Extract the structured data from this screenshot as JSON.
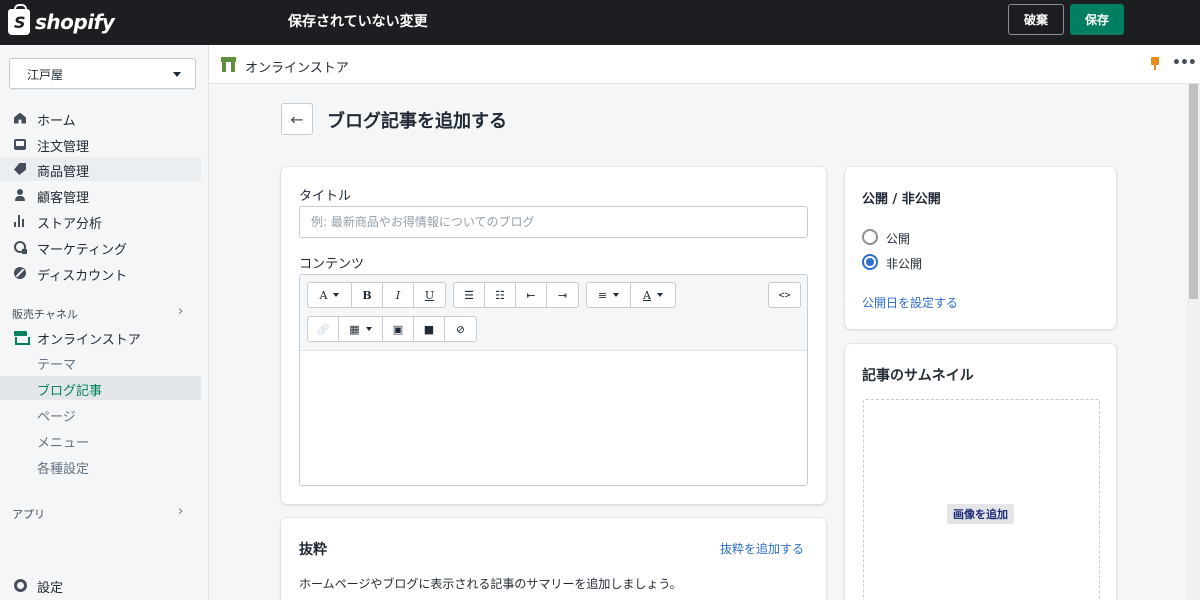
{
  "topbar": {
    "brand": "shopify",
    "unsaved_title": "保存されていない変更",
    "discard_label": "破棄",
    "save_label": "保存"
  },
  "sidebar": {
    "store_name": "江戸屋",
    "nav": [
      {
        "label": "ホーム",
        "icon": "home-icon"
      },
      {
        "label": "注文管理",
        "icon": "inbox-icon"
      },
      {
        "label": "商品管理",
        "icon": "tag-icon"
      },
      {
        "label": "顧客管理",
        "icon": "person-icon"
      },
      {
        "label": "ストア分析",
        "icon": "bar-chart-icon"
      },
      {
        "label": "マーケティング",
        "icon": "target-icon"
      },
      {
        "label": "ディスカウント",
        "icon": "discount-icon"
      }
    ],
    "sales_channels_label": "販売チャネル",
    "online_store_label": "オンラインストア",
    "sub_items": [
      "テーマ",
      "ブログ記事",
      "ページ",
      "メニュー",
      "各種設定"
    ],
    "apps_label": "アプリ",
    "settings_label": "設定"
  },
  "strip": {
    "title": "オンラインストア"
  },
  "page": {
    "title": "ブログ記事を追加する"
  },
  "main_card": {
    "title_label": "タイトル",
    "title_placeholder": "例: 最新商品やお得情報についてのブログ",
    "content_label": "コンテンツ",
    "toolbar": {
      "font": "A",
      "bold": "B",
      "italic": "I",
      "underline": "U",
      "html": "<>"
    }
  },
  "excerpt_card": {
    "heading": "抜粋",
    "add_link": "抜粋を追加する",
    "description": "ホームページやブログに表示される記事のサマリーを追加しましょう。"
  },
  "visibility_card": {
    "heading": "公開 / 非公開",
    "options": [
      "公開",
      "非公開"
    ],
    "selected": "非公開",
    "set_date_link": "公開日を設定する"
  },
  "thumbnail_card": {
    "heading": "記事のサムネイル",
    "add_image": "画像を追加"
  },
  "colors": {
    "topbar": "#1c1e22",
    "primary": "#008060",
    "link": "#2c6ecb"
  }
}
